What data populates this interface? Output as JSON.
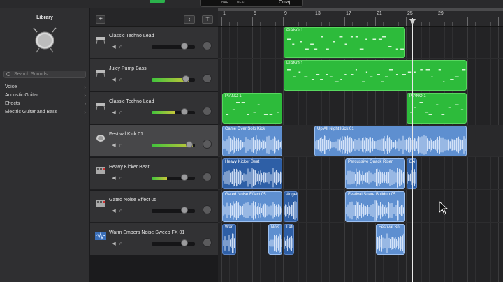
{
  "topbar": {
    "lcd_labels": [
      "BAR",
      "BEAT"
    ],
    "key": "Cmaj"
  },
  "library": {
    "title": "Library",
    "search_placeholder": "Search Sounds",
    "categories": [
      "Voice",
      "Acoustic Guitar",
      "Effects",
      "Electric Guitar and Bass"
    ]
  },
  "track_toolbar": {
    "add_label": "+"
  },
  "ruler": {
    "bars": [
      "1",
      "5",
      "9",
      "13",
      "17",
      "21",
      "25",
      "29"
    ]
  },
  "tracks": [
    {
      "name": "Classic Techno Lead",
      "icon": "synth-keyboard-icon",
      "volume": 0.0,
      "selected": false
    },
    {
      "name": "Juicy Pump Bass",
      "icon": "synth-keyboard-icon",
      "volume": 0.85,
      "selected": false
    },
    {
      "name": "Classic Techno Lead",
      "icon": "synth-keyboard-icon",
      "volume": 0.55,
      "selected": false
    },
    {
      "name": "Festival Kick 01",
      "icon": "drum-icon",
      "volume": 0.95,
      "selected": true
    },
    {
      "name": "Heavy Kicker Beat",
      "icon": "drum-machine-icon",
      "volume": 0.35,
      "selected": false
    },
    {
      "name": "Gated Noise Effect 05",
      "icon": "drum-machine-icon",
      "volume": 0.0,
      "selected": false
    },
    {
      "name": "Warm Embers Noise Sweep FX 01",
      "icon": "waveform-icon",
      "volume": 0.0,
      "selected": false
    }
  ],
  "regions": [
    {
      "lane": 0,
      "type": "midi",
      "label": "PIANO 1",
      "start": 9,
      "end": 25
    },
    {
      "lane": 1,
      "type": "midi",
      "label": "PIANO 1",
      "start": 9,
      "end": 33
    },
    {
      "lane": 2,
      "type": "midi",
      "label": "PIANO 1",
      "start": 1,
      "end": 9
    },
    {
      "lane": 2,
      "type": "midi",
      "label": "PIANO 1",
      "start": 25,
      "end": 33
    },
    {
      "lane": 3,
      "type": "audio",
      "label": "Came Over Solo Kick",
      "start": 1,
      "end": 9
    },
    {
      "lane": 3,
      "type": "audio",
      "label": "Up All Night Kick 01",
      "start": 13,
      "end": 33
    },
    {
      "lane": 4,
      "type": "audio dark",
      "label": "Heavy Kicker Beat",
      "start": 1,
      "end": 9
    },
    {
      "lane": 4,
      "type": "audio",
      "label": "Percussive Quack Riser",
      "start": 17,
      "end": 25
    },
    {
      "lane": 4,
      "type": "audio dark",
      "label": "Exi",
      "start": 25,
      "end": 26.5
    },
    {
      "lane": 5,
      "type": "audio",
      "label": "Gated Noise Effect 05",
      "start": 1,
      "end": 9
    },
    {
      "lane": 5,
      "type": "audio dark",
      "label": "Angel",
      "start": 9,
      "end": 11
    },
    {
      "lane": 5,
      "type": "audio",
      "label": "Festival Snare Buildup 05",
      "start": 17,
      "end": 25
    },
    {
      "lane": 6,
      "type": "audio dark",
      "label": "War",
      "start": 1,
      "end": 3
    },
    {
      "lane": 6,
      "type": "audio",
      "label": "Nois",
      "start": 7,
      "end": 9
    },
    {
      "lane": 6,
      "type": "audio dark",
      "label": "Lati",
      "start": 9,
      "end": 10.5
    },
    {
      "lane": 6,
      "type": "audio",
      "label": "Festival Sn",
      "start": 21,
      "end": 25
    }
  ],
  "playhead_bar": 26,
  "colors": {
    "midi": "#2dbb3b",
    "audio": "#5e8fd0",
    "selected_track": "#474749"
  }
}
